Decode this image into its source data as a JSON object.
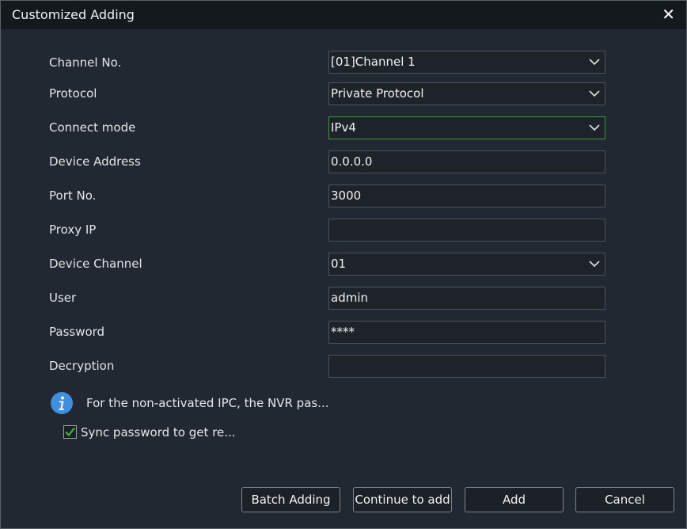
{
  "dialog": {
    "title": "Customized Adding",
    "close_label": "✕"
  },
  "form": {
    "channel_no": {
      "label": "Channel No.",
      "value": "[01]Channel 1"
    },
    "protocol": {
      "label": "Protocol",
      "value": "Private Protocol"
    },
    "connect_mode": {
      "label": "Connect mode",
      "value": "IPv4"
    },
    "device_address": {
      "label": "Device Address",
      "value": "0.0.0.0"
    },
    "port_no": {
      "label": "Port No.",
      "value": "3000"
    },
    "proxy_ip": {
      "label": "Proxy IP",
      "value": ""
    },
    "device_channel": {
      "label": "Device Channel",
      "value": "01"
    },
    "user": {
      "label": "User",
      "value": "admin"
    },
    "password": {
      "label": "Password",
      "value": "****"
    },
    "decryption": {
      "label": "Decryption",
      "value": ""
    }
  },
  "info_note": "For the non-activated IPC, the NVR pas...",
  "sync_password": {
    "label": "Sync password to get re...",
    "checked": true
  },
  "buttons": {
    "batch_adding": "Batch Adding",
    "continue_to_add": "Continue to add",
    "add": "Add",
    "cancel": "Cancel"
  },
  "colors": {
    "titlebar": "#14191e",
    "panel": "#222831",
    "field_border": "#4c535b",
    "focus_border": "#3d9a3f",
    "check_green": "#3fbf3f",
    "info_blue": "#3f8fe0"
  },
  "icons": {
    "close": "close-icon",
    "dropdown": "chevron-down-icon",
    "info": "info-icon",
    "check": "check-icon"
  }
}
